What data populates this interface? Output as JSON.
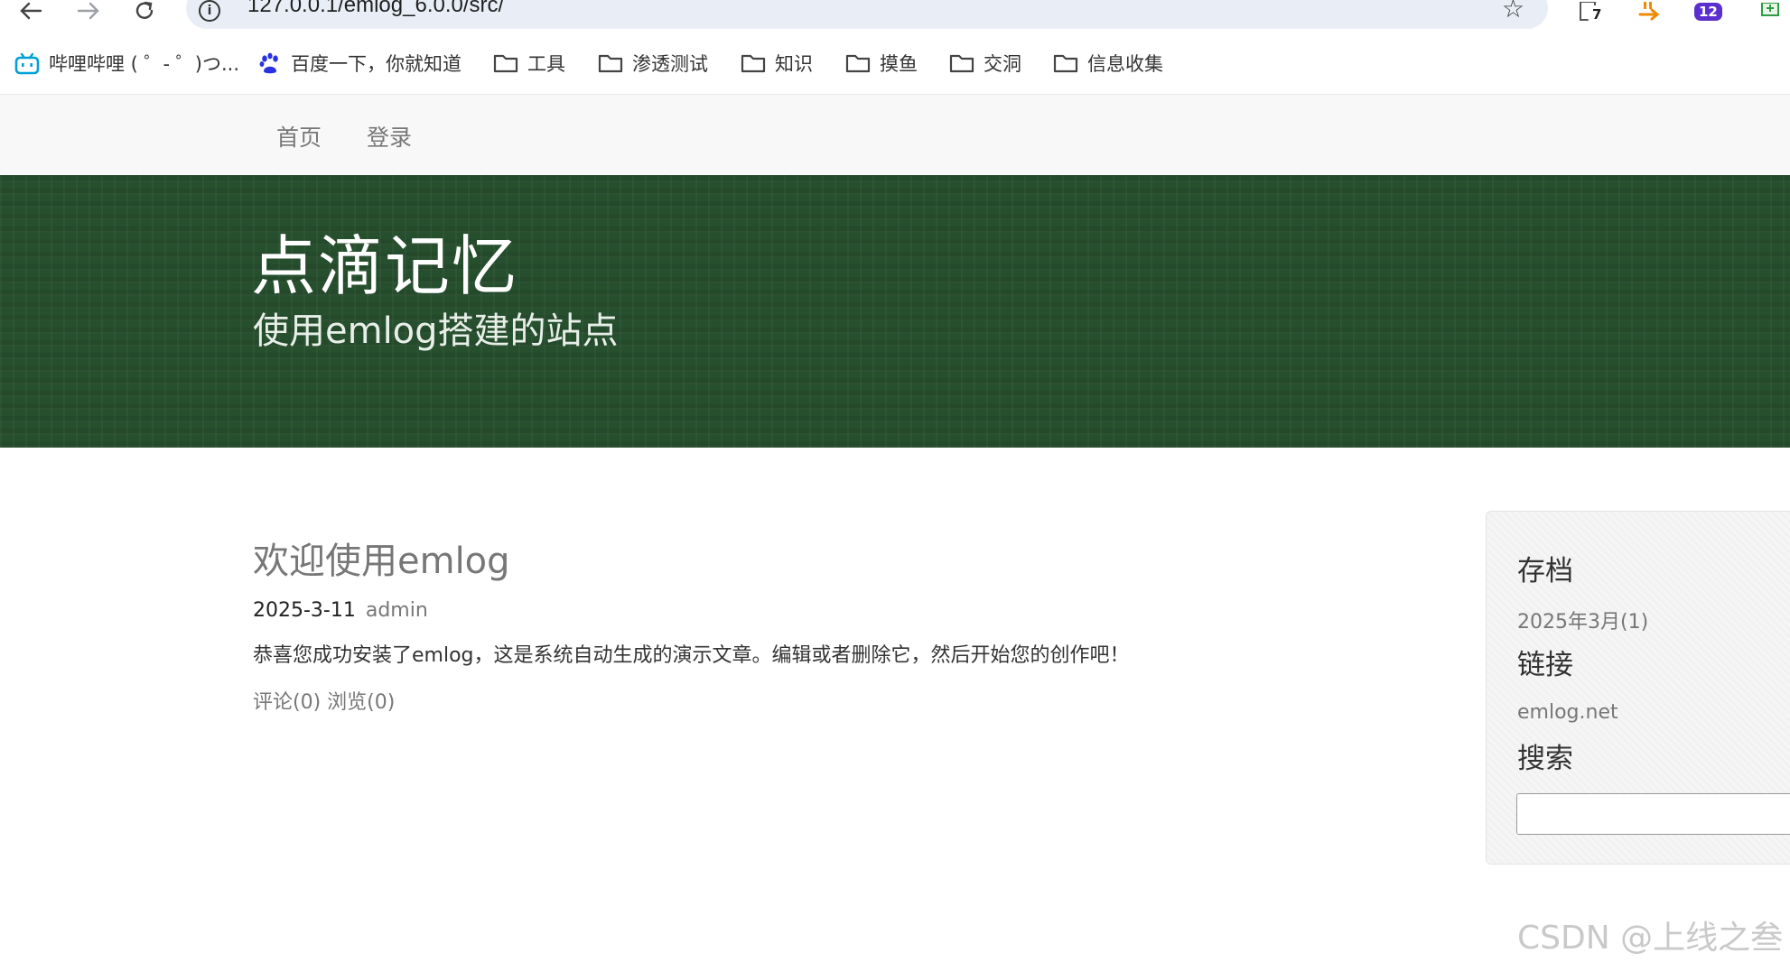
{
  "browser": {
    "url": "127.0.0.1/emlog_6.0.0/src/",
    "extension_badges": [
      "7",
      "12"
    ]
  },
  "bookmarks": [
    {
      "label": "哔哩哔哩 ( ゜- ゜)つ...",
      "icon": "bilibili-icon"
    },
    {
      "label": "百度一下，你就知道",
      "icon": "baidu-paw-icon"
    },
    {
      "label": "工具",
      "icon": "folder-icon"
    },
    {
      "label": "渗透测试",
      "icon": "folder-icon"
    },
    {
      "label": "知识",
      "icon": "folder-icon"
    },
    {
      "label": "摸鱼",
      "icon": "folder-icon"
    },
    {
      "label": "交洞",
      "icon": "folder-icon"
    },
    {
      "label": "信息收集",
      "icon": "folder-icon"
    }
  ],
  "navbar": {
    "home": "首页",
    "login": "登录"
  },
  "header": {
    "title": "点滴记忆",
    "subtitle": "使用emlog搭建的站点"
  },
  "post": {
    "title": "欢迎使用emlog",
    "date": "2025-3-11",
    "author": "admin",
    "content": "恭喜您成功安装了emlog，这是系统自动生成的演示文章。编辑或者删除它，然后开始您的创作吧！",
    "comments": "评论(0)",
    "views": "浏览(0)"
  },
  "sidebar": {
    "archive_heading": "存档",
    "archive_item": "2025年3月(1)",
    "links_heading": "链接",
    "link_item": "emlog.net",
    "search_heading": "搜索",
    "search_value": ""
  },
  "watermark": "CSDN @上线之叁",
  "colors": {
    "banner_bg": "#264f2e",
    "navbar_bg": "#f8f8f8",
    "sidebar_bg": "#f5f5f5",
    "muted_text": "#777777"
  }
}
